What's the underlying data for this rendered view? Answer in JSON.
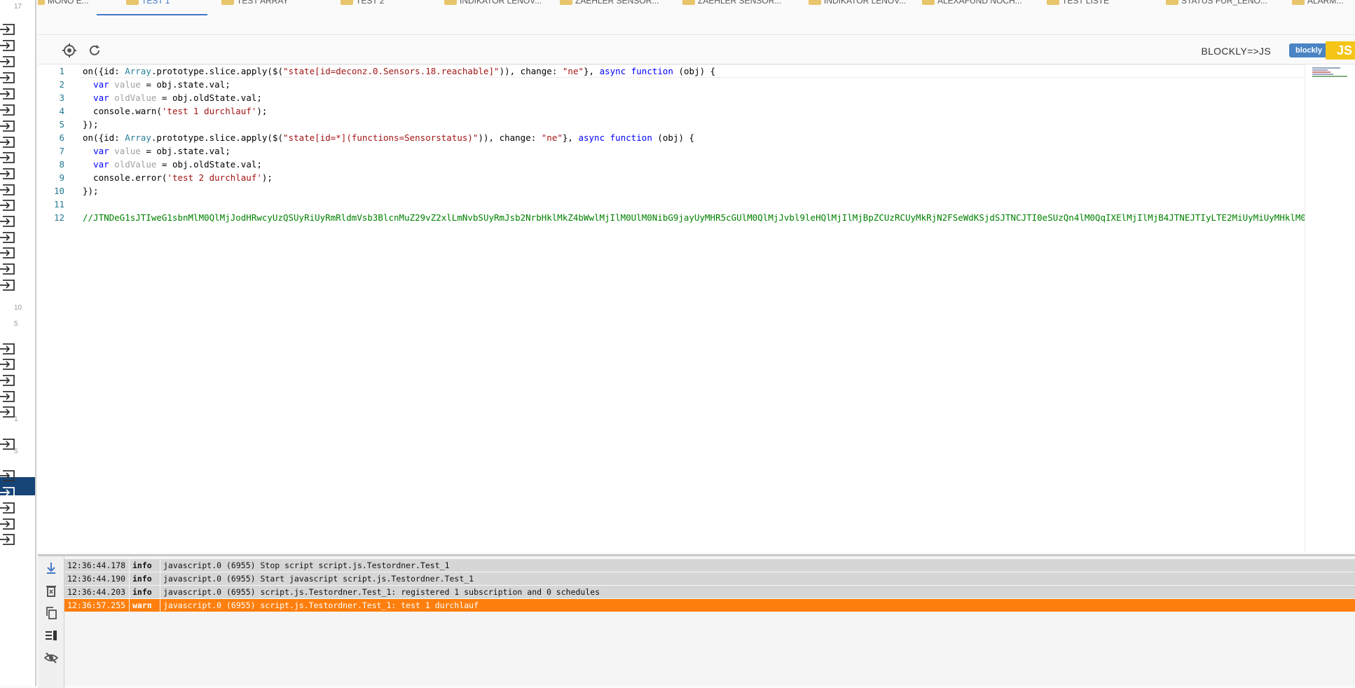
{
  "sidebar": {
    "numbers": [
      "17",
      "10",
      "5",
      "1",
      "5"
    ],
    "item_count": 26
  },
  "tabs": [
    {
      "label": "MONO E..."
    },
    {
      "label": "TEST 1"
    },
    {
      "label": "TEST ARRAY"
    },
    {
      "label": "TEST 2"
    },
    {
      "label": "INDIKATOR LENOV..."
    },
    {
      "label": "ZAEHLER SENSOR..."
    },
    {
      "label": "ZAEHLER SENSOR..."
    },
    {
      "label": "INDIKATOR LENOV..."
    },
    {
      "label": "ALEXAFUND NOCH..."
    },
    {
      "label": "TEST LISTE"
    },
    {
      "label": "STATUS FUR_LENO..."
    },
    {
      "label": "ALARM..."
    }
  ],
  "toolbar": {
    "blockly_js_label": "BLOCKLY=>JS",
    "badge_left": "blockly",
    "badge_right": "JS"
  },
  "editor": {
    "line_numbers": [
      "1",
      "2",
      "3",
      "4",
      "5",
      "6",
      "7",
      "8",
      "9",
      "10",
      "11",
      "12"
    ]
  },
  "log": {
    "rows": [
      {
        "time": "12:36:44.178",
        "severity": "info",
        "message": "javascript.0 (6955) Stop script script.js.Testordner.Test_1"
      },
      {
        "time": "12:36:44.190",
        "severity": "info",
        "message": "javascript.0 (6955) Start javascript script.js.Testordner.Test_1"
      },
      {
        "time": "12:36:44.203",
        "severity": "info",
        "message": "javascript.0 (6955) script.js.Testordner.Test_1: registered 1 subscription and 0 schedules"
      },
      {
        "time": "12:36:57.255",
        "severity": "warn",
        "message": "javascript.0 (6955) script.js.Testordner.Test_1: test 1 durchlauf"
      }
    ]
  },
  "colors": {
    "accent": "#3f76c7",
    "warn_row": "#ff7f0e",
    "sidebar_active": "#164477"
  }
}
